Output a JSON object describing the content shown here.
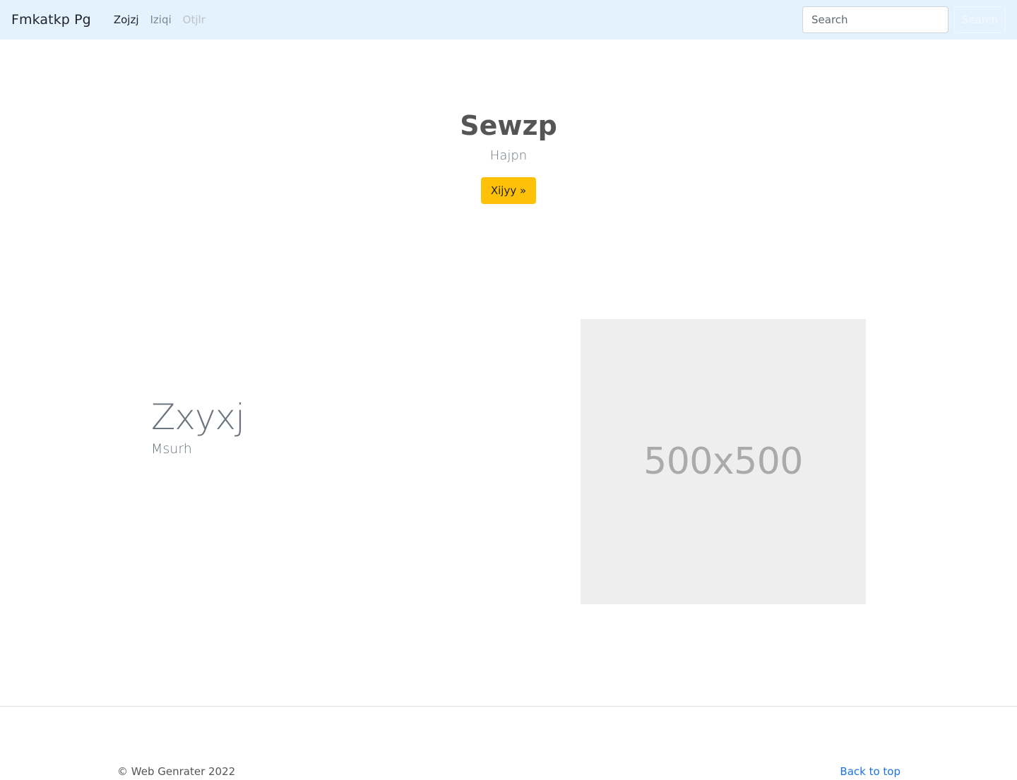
{
  "navbar": {
    "brand": "Fmkatkp Pg",
    "links": [
      {
        "label": "Zojzj",
        "state": "active"
      },
      {
        "label": "Iziqi",
        "state": "normal"
      },
      {
        "label": "Otjlr",
        "state": "disabled"
      }
    ],
    "search": {
      "placeholder": "Search",
      "button_label": "Search"
    },
    "background_color": "#e3f2fd"
  },
  "hero": {
    "title": "Sewzp",
    "subtitle": "Hajpn",
    "button_label": "Xijyy »",
    "button_color": "#ffc107"
  },
  "feature": {
    "title": "Zxyxj",
    "subtitle": "Msurh",
    "image": {
      "label": "500x500",
      "background_color": "#eeeeee"
    }
  },
  "footer": {
    "copyright": "© Web Genrater 2022",
    "back_to_top": "Back to top",
    "link_color": "#1a73e8"
  }
}
